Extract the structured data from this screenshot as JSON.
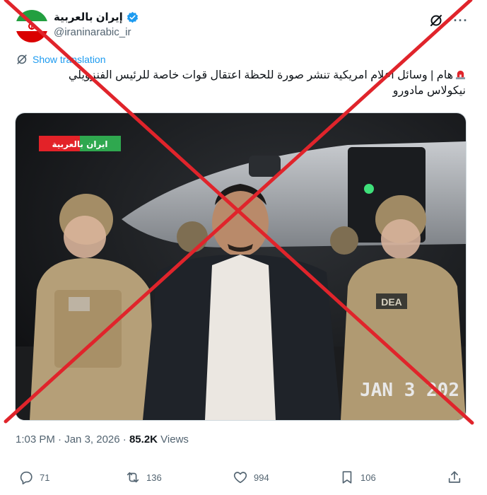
{
  "account": {
    "display_name": "إيران بالعربية",
    "handle": "@iraninarabic_ir",
    "avatar_icon": "iran-flag-icon",
    "verified_icon": "verified-badge-icon",
    "brand_color": "#1d9bf0"
  },
  "translation": {
    "label": "Show translation"
  },
  "tweet": {
    "text": "هام | وسائل اعلام امريكية تنشر صورة للحظة اعتقال قوات خاصة للرئيس الفنزويلي نيكولاس مادورو",
    "leading_icon": "police-siren-emoji"
  },
  "media": {
    "watermark": "ایران بالعربیة",
    "patch": "DEA",
    "date_stamp": "JAN 3 202",
    "overlay_icon": "red-cross-mark"
  },
  "meta": {
    "time": "1:03 PM",
    "separator": "·",
    "date": "Jan 3, 2026",
    "views_count": "85.2K",
    "views_label": "Views"
  },
  "actions": {
    "replies": "71",
    "reposts": "136",
    "likes": "994",
    "bookmarks": "106"
  },
  "colors": {
    "text": "#0f1419",
    "secondary": "#536471",
    "cross": "#e0242b"
  }
}
